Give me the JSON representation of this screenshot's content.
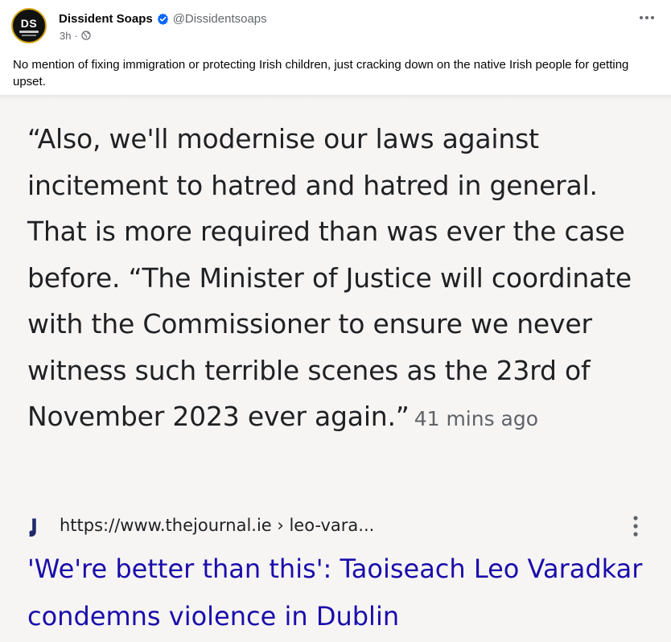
{
  "post": {
    "author": "Dissident Soaps",
    "handle": "@Dissidentsoaps",
    "avatar_initials": "DS",
    "time": "3h",
    "meta_separator": "·",
    "caption": "No mention of fixing immigration or protecting Irish children, just cracking down on the native Irish people for getting upset."
  },
  "screenshot": {
    "quote": "“Also, we'll modernise our laws against incitement to hatred and hatred in general. That is more required than was ever the case before. “The Minister of Justice will coordinate with the Commissioner to ensure we never witness such terrible scenes as the 23rd of November 2023 ever again.”",
    "quote_time": "41 mins ago",
    "result_site_icon_letter": "J",
    "result_url": "https://www.thejournal.ie › leo-vara...",
    "result_title": "'We're better than this': Taoiseach Leo Varadkar condemns violence in Dublin"
  },
  "icons": {
    "verified": "verified-badge-icon",
    "globe": "globe-icon",
    "more": "more-options-icon",
    "result_menu": "vertical-dots-icon"
  },
  "colors": {
    "verified_blue": "#0866ff",
    "link_blue": "#1a0dab",
    "avatar_ring": "#d4a514"
  }
}
